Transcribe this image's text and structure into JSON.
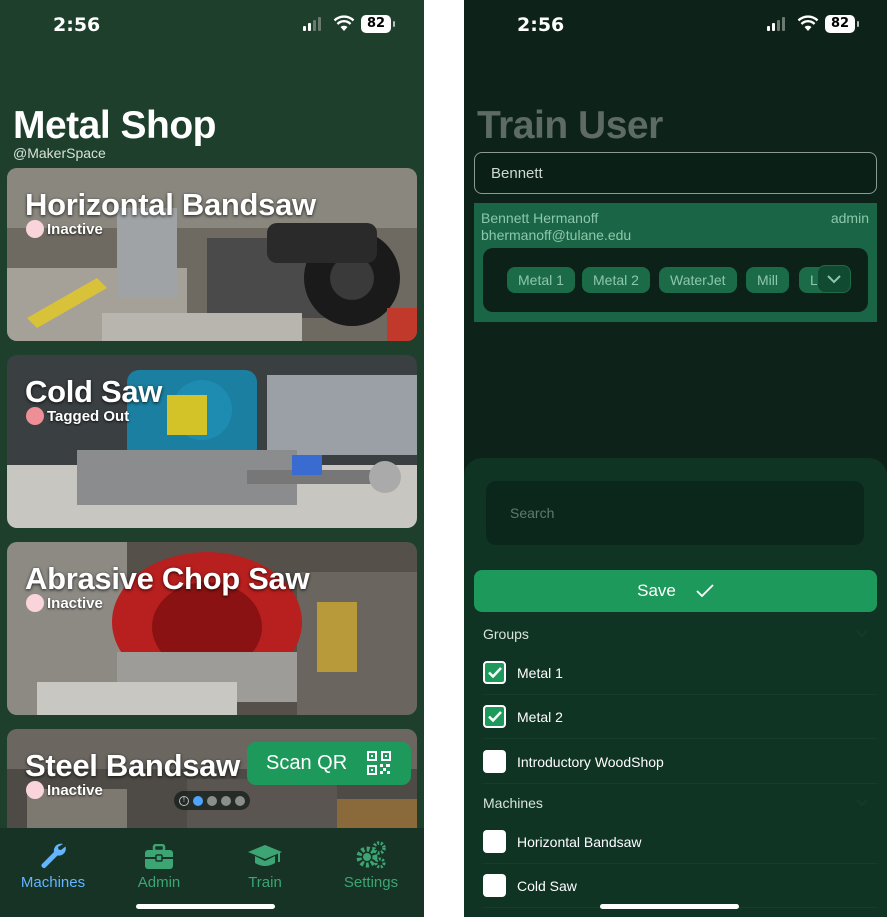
{
  "status_bar": {
    "time": "2:56",
    "battery": "82"
  },
  "left": {
    "title": "Metal Shop",
    "subtitle": "@MakerSpace",
    "machines": [
      {
        "name": "Horizontal Bandsaw",
        "status": "Inactive"
      },
      {
        "name": "Cold Saw",
        "status": "Tagged Out"
      },
      {
        "name": "Abrasive Chop Saw",
        "status": "Inactive"
      },
      {
        "name": "Steel Bandsaw",
        "status": "Inactive"
      }
    ],
    "scan_qr_label": "Scan QR",
    "pager": {
      "count": 4,
      "current": 1
    },
    "tabs": [
      {
        "label": "Machines",
        "icon": "wrench-icon",
        "active": true
      },
      {
        "label": "Admin",
        "icon": "briefcase-icon",
        "active": false
      },
      {
        "label": "Train",
        "icon": "graduation-cap-icon",
        "active": false
      },
      {
        "label": "Settings",
        "icon": "gears-icon",
        "active": false
      }
    ]
  },
  "right": {
    "title": "Train User",
    "user_search_value": "Bennett",
    "user": {
      "name": "Bennett Hermanoff",
      "email": "bhermanoff@tulane.edu",
      "role": "admin",
      "trainings": [
        "Metal 1",
        "Metal 2",
        "WaterJet",
        "Mill",
        "L"
      ]
    },
    "search_placeholder": "Search",
    "save_label": "Save",
    "groups_heading": "Groups",
    "groups": [
      {
        "label": "Metal 1",
        "checked": true
      },
      {
        "label": "Metal 2",
        "checked": true
      },
      {
        "label": "Introductory WoodShop",
        "checked": false
      }
    ],
    "machines_heading": "Machines",
    "machines": [
      {
        "label": "Horizontal Bandsaw",
        "checked": false
      },
      {
        "label": "Cold Saw",
        "checked": false
      }
    ]
  },
  "colors": {
    "accent_green": "#1d9a5b",
    "active_tab_blue": "#64b4ff",
    "tagged_out_red": "#ee8f98",
    "inactive_pink": "#f9d5db"
  }
}
